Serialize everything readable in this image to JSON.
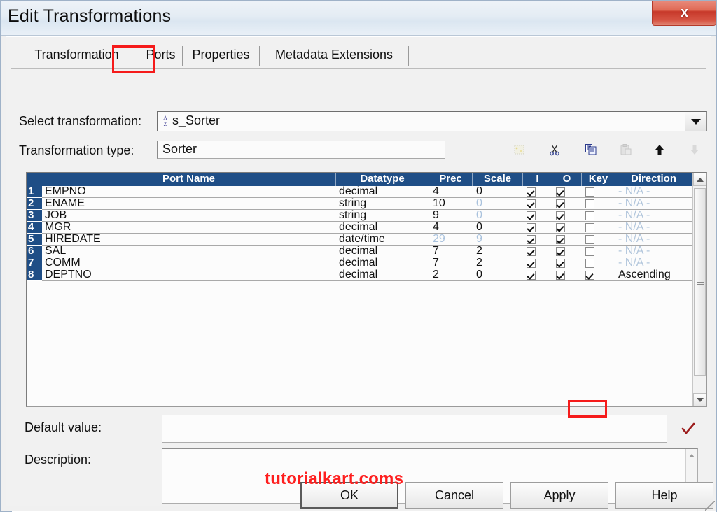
{
  "window": {
    "title": "Edit Transformations",
    "close_label": "x"
  },
  "tabs": [
    {
      "label": "Transformation",
      "selected": false
    },
    {
      "label": "Ports",
      "selected": true
    },
    {
      "label": "Properties",
      "selected": false
    },
    {
      "label": "Metadata Extensions",
      "selected": false
    }
  ],
  "select_transformation": {
    "label": "Select transformation:",
    "value": "s_Sorter",
    "icon": "sorter-az-icon",
    "arrow_icon": "chevron-down-icon"
  },
  "transformation_type": {
    "label": "Transformation type:",
    "value": "Sorter"
  },
  "toolbar": [
    {
      "name": "new-port-icon",
      "title": "Add new port",
      "enabled": false
    },
    {
      "name": "cut-icon",
      "title": "Cut",
      "enabled": true
    },
    {
      "name": "copy-icon",
      "title": "Copy",
      "enabled": true
    },
    {
      "name": "paste-icon",
      "title": "Paste",
      "enabled": false
    },
    {
      "name": "move-up-icon",
      "title": "Move up",
      "enabled": true
    },
    {
      "name": "move-down-icon",
      "title": "Move down",
      "enabled": false
    }
  ],
  "ports_grid": {
    "columns": [
      "Port Name",
      "Datatype",
      "Prec",
      "Scale",
      "I",
      "O",
      "Key",
      "Direction"
    ],
    "rows": [
      {
        "n": "1",
        "port_name": "EMPNO",
        "datatype": "decimal",
        "prec": "4",
        "prec_dim": false,
        "scale": "0",
        "scale_dim": false,
        "i": true,
        "o": true,
        "key": false,
        "direction": "- N/A -",
        "direction_na": true
      },
      {
        "n": "2",
        "port_name": "ENAME",
        "datatype": "string",
        "prec": "10",
        "prec_dim": false,
        "scale": "0",
        "scale_dim": true,
        "i": true,
        "o": true,
        "key": false,
        "direction": "- N/A -",
        "direction_na": true
      },
      {
        "n": "3",
        "port_name": "JOB",
        "datatype": "string",
        "prec": "9",
        "prec_dim": false,
        "scale": "0",
        "scale_dim": true,
        "i": true,
        "o": true,
        "key": false,
        "direction": "- N/A -",
        "direction_na": true
      },
      {
        "n": "4",
        "port_name": "MGR",
        "datatype": "decimal",
        "prec": "4",
        "prec_dim": false,
        "scale": "0",
        "scale_dim": false,
        "i": true,
        "o": true,
        "key": false,
        "direction": "- N/A -",
        "direction_na": true
      },
      {
        "n": "5",
        "port_name": "HIREDATE",
        "datatype": "date/time",
        "prec": "29",
        "prec_dim": true,
        "scale": "9",
        "scale_dim": true,
        "i": true,
        "o": true,
        "key": false,
        "direction": "- N/A -",
        "direction_na": true
      },
      {
        "n": "6",
        "port_name": "SAL",
        "datatype": "decimal",
        "prec": "7",
        "prec_dim": false,
        "scale": "2",
        "scale_dim": false,
        "i": true,
        "o": true,
        "key": false,
        "direction": "- N/A -",
        "direction_na": true
      },
      {
        "n": "7",
        "port_name": "COMM",
        "datatype": "decimal",
        "prec": "7",
        "prec_dim": false,
        "scale": "2",
        "scale_dim": false,
        "i": true,
        "o": true,
        "key": false,
        "direction": "- N/A -",
        "direction_na": true
      },
      {
        "n": "8",
        "port_name": "DEPTNO",
        "datatype": "decimal",
        "prec": "2",
        "prec_dim": false,
        "scale": "0",
        "scale_dim": false,
        "i": true,
        "o": true,
        "key": true,
        "direction": "Ascending",
        "direction_na": false
      }
    ]
  },
  "watermark": "tutorialkart.coms",
  "default_value": {
    "label": "Default value:",
    "value": "",
    "validate_icon": "red-checkmark-icon"
  },
  "description": {
    "label": "Description:",
    "value": ""
  },
  "footer_buttons": [
    {
      "label": "OK",
      "default": true
    },
    {
      "label": "Cancel",
      "default": false
    },
    {
      "label": "Apply",
      "default": false
    },
    {
      "label": "Help",
      "default": false
    }
  ],
  "highlights": {
    "tab_highlight_color": "#f51b1b",
    "key_checkbox_highlight_color": "#f51b1b"
  },
  "colors": {
    "header_blue": "#1f4e86",
    "close_red": "#c7392a",
    "watermark_red": "#fe1f1f",
    "na_text": "#b2c6dc"
  }
}
